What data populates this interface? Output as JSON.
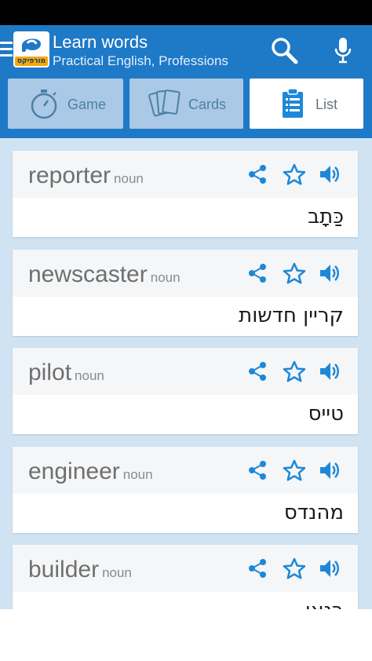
{
  "app": {
    "title": "Learn words",
    "subtitle": "Practical English, Professions",
    "logo_text": "מורפיקס"
  },
  "tabs": [
    {
      "label": "Game",
      "icon": "stopwatch-icon",
      "active": false
    },
    {
      "label": "Cards",
      "icon": "cards-icon",
      "active": false
    },
    {
      "label": "List",
      "icon": "clipboard-list-icon",
      "active": true
    }
  ],
  "words": [
    {
      "word": "reporter",
      "pos": "noun",
      "translation": "כַּתָב"
    },
    {
      "word": "newscaster",
      "pos": "noun",
      "translation": "קריין חדשות"
    },
    {
      "word": "pilot",
      "pos": "noun",
      "translation": "טייס"
    },
    {
      "word": "engineer",
      "pos": "noun",
      "translation": "מהנדס"
    },
    {
      "word": "builder",
      "pos": "noun",
      "translation": "בנאי"
    }
  ],
  "colors": {
    "appbar": "#1e79c7",
    "content_bg": "#cfe3f3",
    "icon_blue": "#1e88d8",
    "tab_inactive": "#a9c9e6"
  }
}
